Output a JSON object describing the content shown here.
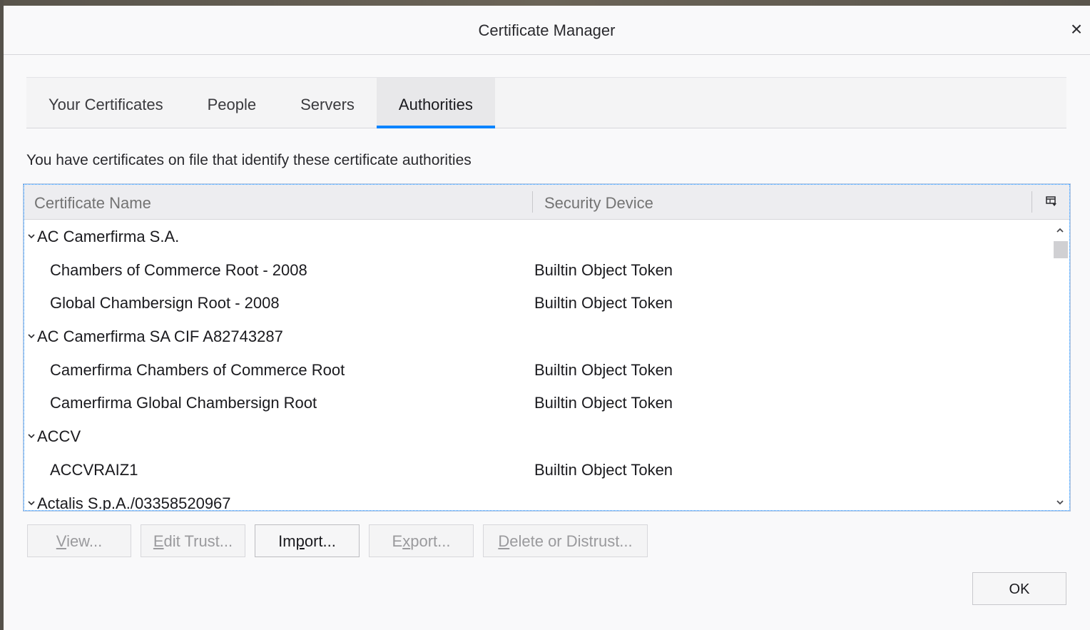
{
  "dialog": {
    "title": "Certificate Manager",
    "close_glyph": "×"
  },
  "tabs": [
    {
      "label": "Your Certificates",
      "selected": false
    },
    {
      "label": "People",
      "selected": false
    },
    {
      "label": "Servers",
      "selected": false
    },
    {
      "label": "Authorities",
      "selected": true
    }
  ],
  "description": "You have certificates on file that identify these certificate authorities",
  "tree": {
    "columns": {
      "name": "Certificate Name",
      "device": "Security Device"
    },
    "rows": [
      {
        "type": "group",
        "name": "AC Camerfirma S.A.",
        "device": ""
      },
      {
        "type": "item",
        "name": "Chambers of Commerce Root - 2008",
        "device": "Builtin Object Token"
      },
      {
        "type": "item",
        "name": "Global Chambersign Root - 2008",
        "device": "Builtin Object Token"
      },
      {
        "type": "group",
        "name": "AC Camerfirma SA CIF A82743287",
        "device": ""
      },
      {
        "type": "item",
        "name": "Camerfirma Chambers of Commerce Root",
        "device": "Builtin Object Token"
      },
      {
        "type": "item",
        "name": "Camerfirma Global Chambersign Root",
        "device": "Builtin Object Token"
      },
      {
        "type": "group",
        "name": "ACCV",
        "device": ""
      },
      {
        "type": "item",
        "name": "ACCVRAIZ1",
        "device": "Builtin Object Token"
      },
      {
        "type": "group",
        "name": "Actalis S.p.A./03358520967",
        "device": ""
      }
    ]
  },
  "buttons": {
    "view": {
      "pre": "",
      "key": "V",
      "post": "iew..."
    },
    "edit_trust": {
      "pre": "",
      "key": "E",
      "post": "dit Trust..."
    },
    "import": {
      "pre": "Im",
      "key": "p",
      "post": "ort..."
    },
    "export": {
      "pre": "E",
      "key": "x",
      "post": "port..."
    },
    "delete": {
      "pre": "",
      "key": "D",
      "post": "elete or Distrust..."
    },
    "ok": "OK"
  },
  "colors": {
    "accent": "#0a84ff",
    "background": "#f9f9fa"
  }
}
